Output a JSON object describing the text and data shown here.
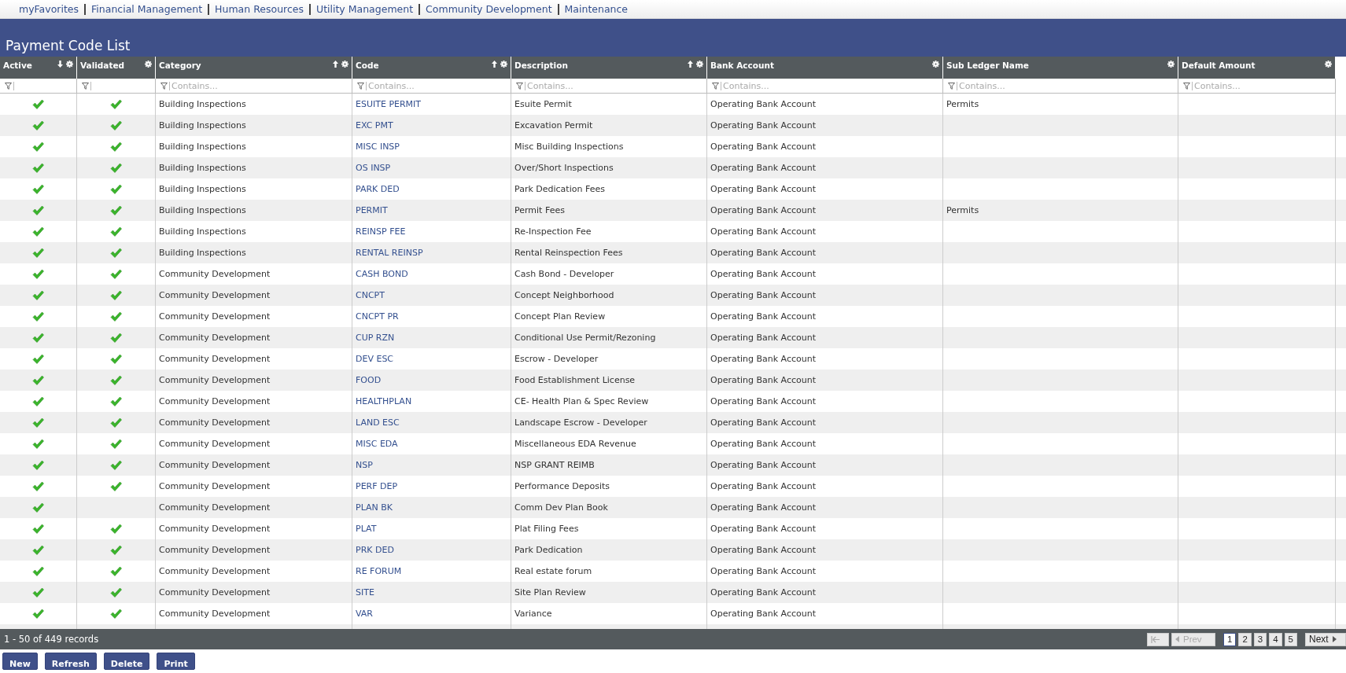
{
  "nav_links": [
    "myFavorites",
    "Financial Management",
    "Human Resources",
    "Utility Management",
    "Community Development",
    "Maintenance"
  ],
  "page_title": "Payment Code List",
  "columns": [
    {
      "label": "Active",
      "sorted": true,
      "sort_desc": true
    },
    {
      "label": "Validated",
      "sorted": false
    },
    {
      "label": "Category",
      "sorted": true,
      "sort_desc": false,
      "filter_placeholder": "Contains..."
    },
    {
      "label": "Code",
      "sorted": true,
      "sort_desc": false,
      "filter_placeholder": "Contains..."
    },
    {
      "label": "Description",
      "sorted": true,
      "sort_desc": false,
      "filter_placeholder": "Contains..."
    },
    {
      "label": "Bank Account",
      "sorted": false,
      "filter_placeholder": "Contains..."
    },
    {
      "label": "Sub Ledger Name",
      "sorted": false,
      "filter_placeholder": "Contains..."
    },
    {
      "label": "Default Amount",
      "sorted": false,
      "filter_placeholder": "Contains..."
    }
  ],
  "rows": [
    {
      "active": true,
      "validated": true,
      "category": "Building Inspections",
      "code": "ESUITE PERMIT",
      "description": "Esuite Permit",
      "bank_account": "Operating Bank Account",
      "sub_ledger_name": "Permits"
    },
    {
      "active": true,
      "validated": true,
      "category": "Building Inspections",
      "code": "EXC PMT",
      "description": "Excavation Permit",
      "bank_account": "Operating Bank Account"
    },
    {
      "active": true,
      "validated": true,
      "category": "Building Inspections",
      "code": "MISC INSP",
      "description": "Misc Building Inspections",
      "bank_account": "Operating Bank Account"
    },
    {
      "active": true,
      "validated": true,
      "category": "Building Inspections",
      "code": "OS INSP",
      "description": "Over/Short Inspections",
      "bank_account": "Operating Bank Account"
    },
    {
      "active": true,
      "validated": true,
      "category": "Building Inspections",
      "code": "PARK DED",
      "description": "Park Dedication Fees",
      "bank_account": "Operating Bank Account"
    },
    {
      "active": true,
      "validated": true,
      "category": "Building Inspections",
      "code": "PERMIT",
      "description": "Permit Fees",
      "bank_account": "Operating Bank Account",
      "sub_ledger_name": "Permits"
    },
    {
      "active": true,
      "validated": true,
      "category": "Building Inspections",
      "code": "REINSP FEE",
      "description": "Re-Inspection Fee",
      "bank_account": "Operating Bank Account"
    },
    {
      "active": true,
      "validated": true,
      "category": "Building Inspections",
      "code": "RENTAL REINSP",
      "description": "Rental Reinspection Fees",
      "bank_account": "Operating Bank Account"
    },
    {
      "active": true,
      "validated": true,
      "category": "Community Development",
      "code": "CASH BOND",
      "description": "Cash Bond - Developer",
      "bank_account": "Operating Bank Account"
    },
    {
      "active": true,
      "validated": true,
      "category": "Community Development",
      "code": "CNCPT",
      "description": "Concept Neighborhood",
      "bank_account": "Operating Bank Account"
    },
    {
      "active": true,
      "validated": true,
      "category": "Community Development",
      "code": "CNCPT PR",
      "description": "Concept Plan Review",
      "bank_account": "Operating Bank Account"
    },
    {
      "active": true,
      "validated": true,
      "category": "Community Development",
      "code": "CUP RZN",
      "description": "Conditional Use Permit/Rezoning",
      "bank_account": "Operating Bank Account"
    },
    {
      "active": true,
      "validated": true,
      "category": "Community Development",
      "code": "DEV ESC",
      "description": "Escrow - Developer",
      "bank_account": "Operating Bank Account"
    },
    {
      "active": true,
      "validated": true,
      "category": "Community Development",
      "code": "FOOD",
      "description": "Food Establishment License",
      "bank_account": "Operating Bank Account"
    },
    {
      "active": true,
      "validated": true,
      "category": "Community Development",
      "code": "HEALTHPLAN",
      "description": "CE- Health Plan & Spec Review",
      "bank_account": "Operating Bank Account"
    },
    {
      "active": true,
      "validated": true,
      "category": "Community Development",
      "code": "LAND ESC",
      "description": "Landscape Escrow - Developer",
      "bank_account": "Operating Bank Account"
    },
    {
      "active": true,
      "validated": true,
      "category": "Community Development",
      "code": "MISC EDA",
      "description": "Miscellaneous EDA Revenue",
      "bank_account": "Operating Bank Account"
    },
    {
      "active": true,
      "validated": true,
      "category": "Community Development",
      "code": "NSP",
      "description": "NSP GRANT REIMB",
      "bank_account": "Operating Bank Account"
    },
    {
      "active": true,
      "validated": true,
      "category": "Community Development",
      "code": "PERF DEP",
      "description": "Performance Deposits",
      "bank_account": "Operating Bank Account"
    },
    {
      "active": true,
      "validated": false,
      "category": "Community Development",
      "code": "PLAN BK",
      "description": "Comm Dev Plan Book",
      "bank_account": "Operating Bank Account"
    },
    {
      "active": true,
      "validated": true,
      "category": "Community Development",
      "code": "PLAT",
      "description": "Plat Filing Fees",
      "bank_account": "Operating Bank Account"
    },
    {
      "active": true,
      "validated": true,
      "category": "Community Development",
      "code": "PRK DED",
      "description": "Park Dedication",
      "bank_account": "Operating Bank Account"
    },
    {
      "active": true,
      "validated": true,
      "category": "Community Development",
      "code": "RE FORUM",
      "description": "Real estate forum",
      "bank_account": "Operating Bank Account"
    },
    {
      "active": true,
      "validated": true,
      "category": "Community Development",
      "code": "SITE",
      "description": "Site Plan Review",
      "bank_account": "Operating Bank Account"
    },
    {
      "active": true,
      "validated": true,
      "category": "Community Development",
      "code": "VAR",
      "description": "Variance",
      "bank_account": "Operating Bank Account"
    }
  ],
  "record_count": "1 - 50 of 449 records",
  "pager": {
    "first_disabled": true,
    "prev": {
      "label": "Prev",
      "disabled": true
    },
    "pages": [
      {
        "label": "1",
        "selected": true
      },
      {
        "label": "2",
        "selected": false
      },
      {
        "label": "3",
        "selected": false
      },
      {
        "label": "4",
        "selected": false
      },
      {
        "label": "5",
        "selected": false
      }
    ],
    "next": {
      "label": "Next",
      "disabled": false
    }
  },
  "buttons": [
    "New",
    "Refresh",
    "Delete",
    "Print"
  ]
}
